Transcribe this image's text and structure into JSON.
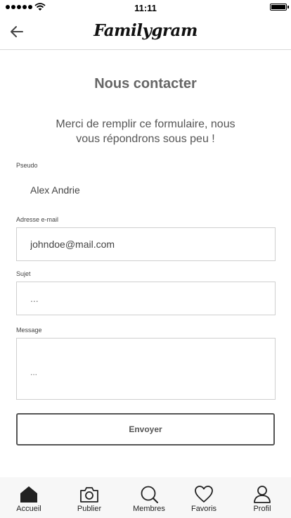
{
  "status_bar": {
    "time": "11:11"
  },
  "header": {
    "logo_text": "Familygram"
  },
  "page": {
    "title": "Nous contacter",
    "intro_line1": "Merci de remplir ce formulaire, nous",
    "intro_line2": "vous répondrons sous peu !"
  },
  "form": {
    "pseudo_label": "Pseudo",
    "pseudo_value": "Alex Andrie",
    "email_label": "Adresse e-mail",
    "email_value": "johndoe@mail.com",
    "subject_label": "Sujet",
    "subject_placeholder": "...",
    "message_label": "Message",
    "message_placeholder": "...",
    "submit_label": "Envoyer"
  },
  "tab_bar": {
    "items": [
      {
        "label": "Accueil",
        "icon": "home-icon",
        "active": true
      },
      {
        "label": "Publier",
        "icon": "camera-icon",
        "active": false
      },
      {
        "label": "Membres",
        "icon": "search-icon",
        "active": false
      },
      {
        "label": "Favoris",
        "icon": "heart-icon",
        "active": false
      },
      {
        "label": "Profil",
        "icon": "user-icon",
        "active": false
      }
    ]
  }
}
